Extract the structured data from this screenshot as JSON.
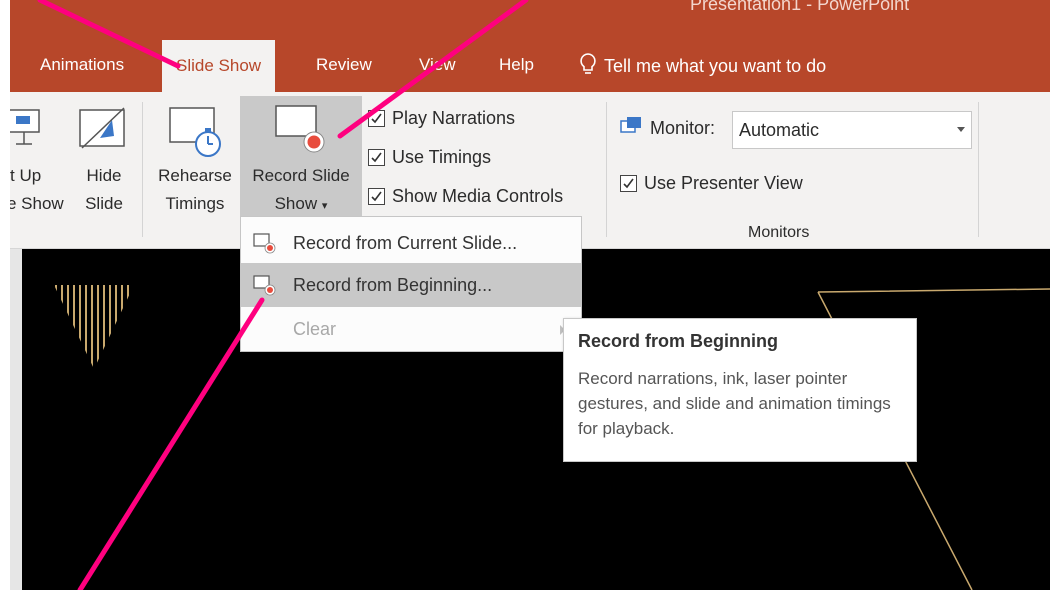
{
  "window": {
    "title": "Presentation1 - PowerPoint"
  },
  "tabs": [
    {
      "label": "Animations"
    },
    {
      "label": "Slide Show",
      "active": true
    },
    {
      "label": "Review"
    },
    {
      "label": "View"
    },
    {
      "label": "Help"
    }
  ],
  "tellme": {
    "label": "Tell me what you want to do",
    "icon": "lightbulb-icon"
  },
  "ribbon": {
    "setup": {
      "line1": "t Up",
      "line2": "e Show",
      "icon": "setup-slideshow-icon"
    },
    "hide": {
      "line1": "Hide",
      "line2": "Slide",
      "icon": "hide-slide-icon"
    },
    "rehearse": {
      "line1": "Rehearse",
      "line2": "Timings",
      "icon": "stopwatch-icon"
    },
    "record": {
      "line1": "Record Slide",
      "line2": "Show",
      "icon": "record-slide-icon"
    },
    "checkboxes": [
      {
        "label": "Play Narrations",
        "checked": true
      },
      {
        "label": "Use Timings",
        "checked": true
      },
      {
        "label": "Show Media Controls",
        "checked": true
      }
    ],
    "monitors": {
      "monitor_label": "Monitor:",
      "monitor_value": "Automatic",
      "presenter_view": {
        "label": "Use Presenter View",
        "checked": true
      },
      "group_label": "Monitors"
    }
  },
  "record_menu": {
    "items": [
      {
        "label": "Record from Current Slide...",
        "state": "normal"
      },
      {
        "label": "Record from Beginning...",
        "state": "hover"
      },
      {
        "label": "Clear",
        "state": "disabled"
      }
    ]
  },
  "tooltip": {
    "title": "Record from Beginning",
    "body": "Record narrations, ink, laser pointer gestures, and slide and animation timings for playback."
  },
  "colors": {
    "accent": "#b7472a",
    "ribbon_bg": "#f3f2f1",
    "annotation": "#ff007f",
    "slide_gold": "#c9a96e",
    "record_dot": "#e84c3d"
  }
}
